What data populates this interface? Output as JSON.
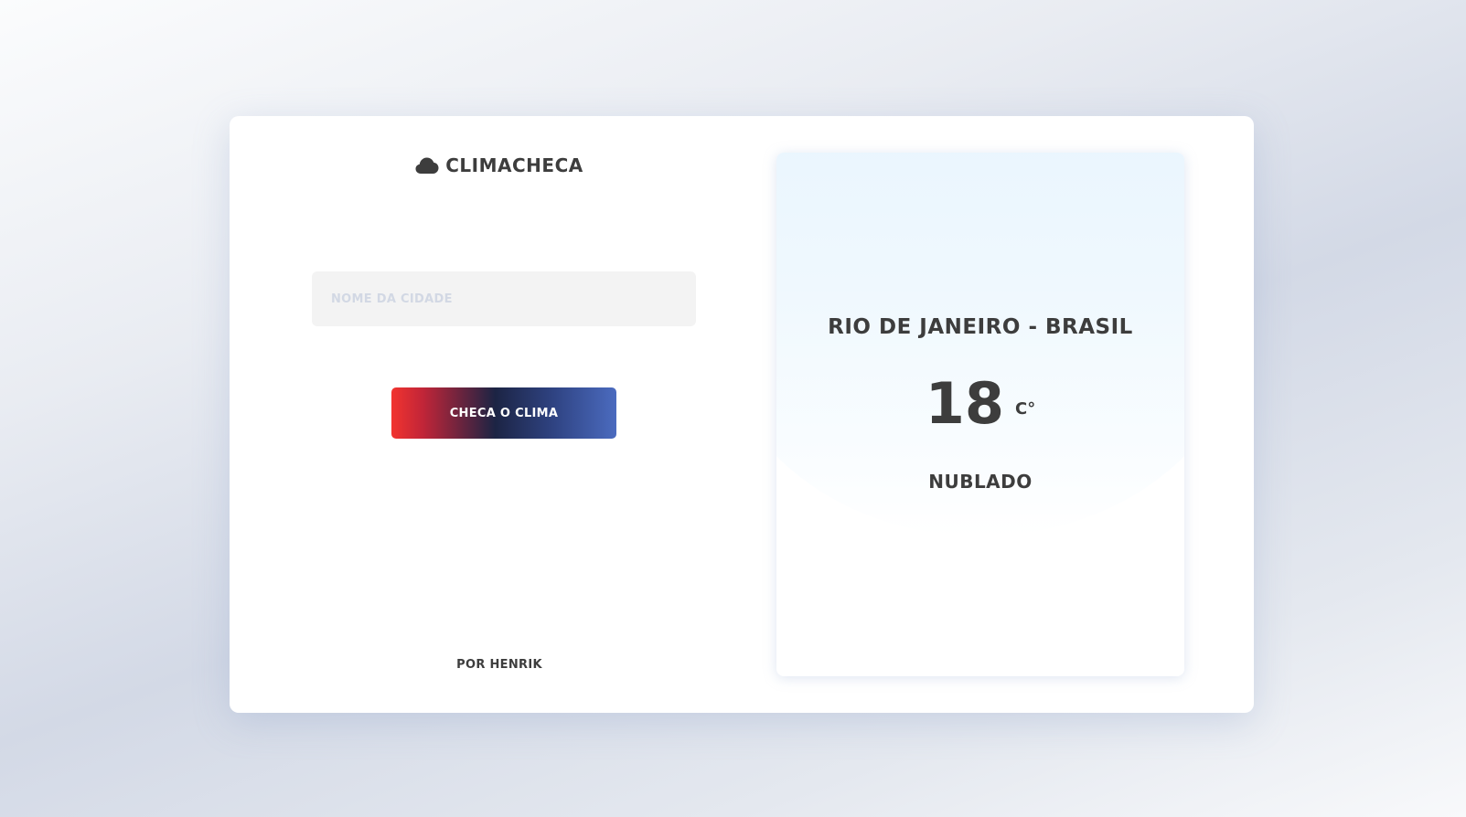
{
  "app": {
    "brand_name": "CLIMACHECA",
    "brand_icon": "cloud-icon",
    "text_color": "#3d3d3d"
  },
  "search": {
    "placeholder": "NOME DA CIDADE",
    "value": ""
  },
  "actions": {
    "check_label": "CHECA O CLIMA",
    "button_gradient": [
      "#f2342f",
      "#1c2444",
      "#4b6bbf"
    ]
  },
  "footer": {
    "author": "POR HENRIK"
  },
  "weather": {
    "location": "RIO DE JANEIRO - BRASIL",
    "temperature": "18",
    "unit": "C°",
    "condition": "NUBLADO"
  }
}
